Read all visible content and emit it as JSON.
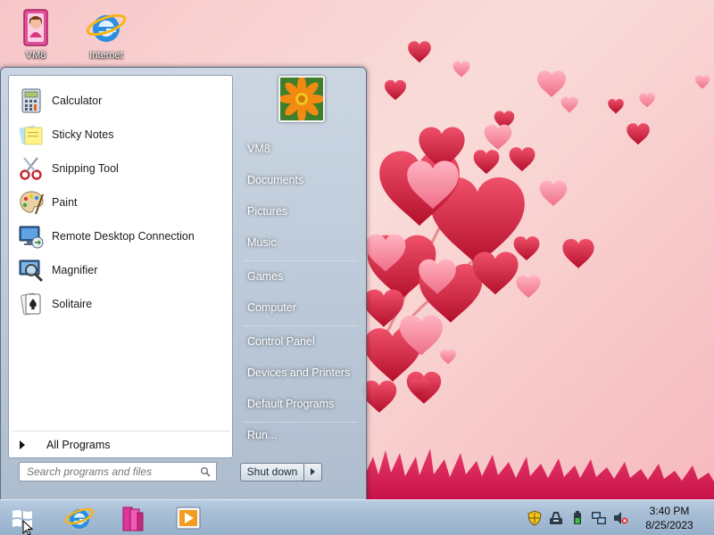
{
  "desktop": {
    "icons": [
      {
        "label": "VM8",
        "icon": "user-folder-icon"
      },
      {
        "label": "Internet",
        "icon": "internet-explorer-icon"
      }
    ]
  },
  "start_menu": {
    "programs": [
      {
        "label": "Calculator",
        "icon": "calculator-icon"
      },
      {
        "label": "Sticky Notes",
        "icon": "sticky-notes-icon"
      },
      {
        "label": "Snipping Tool",
        "icon": "scissors-icon"
      },
      {
        "label": "Paint",
        "icon": "paint-palette-icon"
      },
      {
        "label": "Remote Desktop Connection",
        "icon": "remote-desktop-icon"
      },
      {
        "label": "Magnifier",
        "icon": "magnifier-icon"
      },
      {
        "label": "Solitaire",
        "icon": "playing-card-icon"
      }
    ],
    "all_programs_label": "All Programs",
    "search_placeholder": "Search programs and files",
    "places": [
      {
        "label": "VM8"
      },
      {
        "label": "Documents"
      },
      {
        "label": "Pictures"
      },
      {
        "label": "Music"
      },
      {
        "label": "Games"
      },
      {
        "label": "Computer"
      },
      {
        "label": "Control Panel"
      },
      {
        "label": "Devices and Printers"
      },
      {
        "label": "Default Programs"
      },
      {
        "label": "Run..."
      }
    ],
    "shutdown_label": "Shut down"
  },
  "taskbar": {
    "pinned": [
      {
        "icon": "internet-explorer-icon"
      },
      {
        "icon": "libraries-icon"
      },
      {
        "icon": "media-player-icon"
      }
    ],
    "tray": [
      {
        "icon": "security-shield-icon"
      },
      {
        "icon": "tools-icon"
      },
      {
        "icon": "battery-icon"
      },
      {
        "icon": "network-icon"
      },
      {
        "icon": "volume-muted-icon"
      }
    ],
    "clock": {
      "time": "3:40 PM",
      "date": "8/25/2023"
    }
  },
  "colors": {
    "accent": "#6b86a6",
    "wallpaper_heart": "#d91e3a"
  }
}
